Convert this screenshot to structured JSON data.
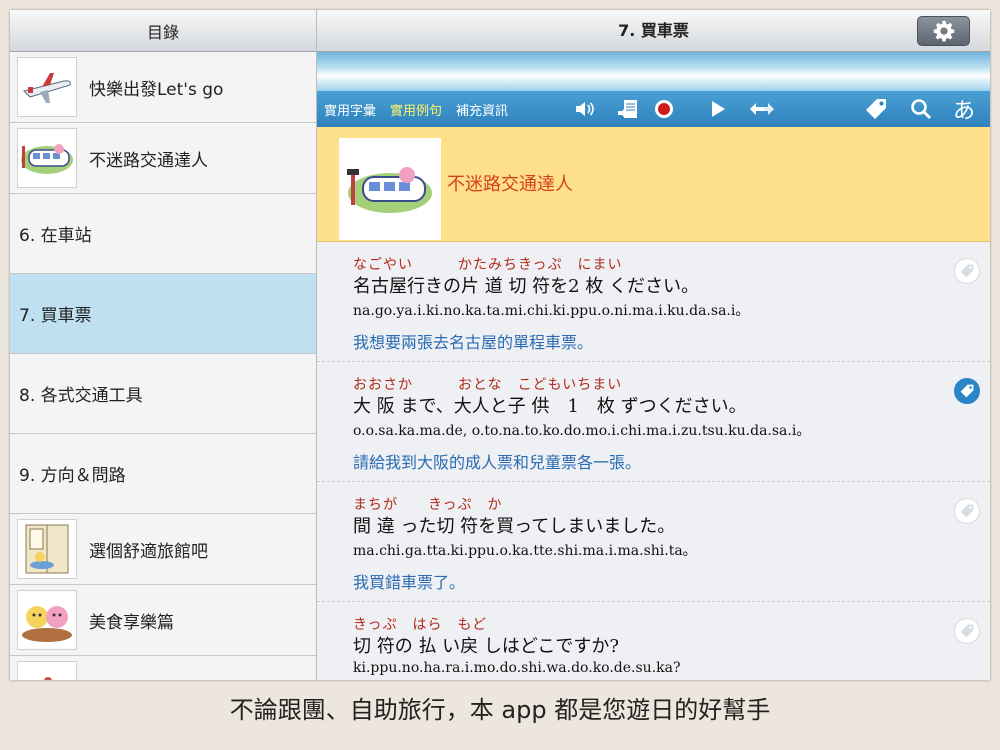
{
  "sidebar": {
    "title": "目錄",
    "items": [
      {
        "label": "快樂出發Let's go",
        "icon": "airplane-icon"
      },
      {
        "label": "不迷路交通達人",
        "icon": "train-icon"
      },
      {
        "label": "6. 在車站"
      },
      {
        "label": "7. 買車票"
      },
      {
        "label": "8. 各式交通工具"
      },
      {
        "label": "9. 方向＆問路"
      },
      {
        "label": "選個舒適旅館吧",
        "icon": "hotel-room-icon"
      },
      {
        "label": "美食享樂篇",
        "icon": "food-icon"
      }
    ],
    "selected_index": 3
  },
  "main": {
    "title": "7. 買車票",
    "tabs": [
      "實用字彙",
      "實用例句",
      "補充資訊"
    ],
    "active_tab": 1,
    "lang_button": "あ",
    "lesson_title": "不迷路交通達人",
    "phrases": [
      {
        "ruby": "なごやい　　　かたみちきっぷ　にまい",
        "japanese": "名古屋行きの片 道 切 符を2 枚 ください。",
        "romaji": "na.go.ya.i.ki.no.ka.ta.mi.chi.ki.ppu.o.ni.ma.i.ku.da.sa.i。",
        "chinese": "我想要兩張去名古屋的單程車票。",
        "tagged": false
      },
      {
        "ruby": "おおさか　　　おとな　こどもいちまい",
        "japanese": "大 阪 まで、大人と子 供　1　枚 ずつください。",
        "romaji": "o.o.sa.ka.ma.de, o.to.na.to.ko.do.mo.i.chi.ma.i.zu.tsu.ku.da.sa.i。",
        "chinese": "請給我到大阪的成人票和兒童票各一張。",
        "tagged": true
      },
      {
        "ruby": "まちが　　きっぷ　か",
        "japanese": "間 違 った切 符を買ってしまいました。",
        "romaji": "ma.chi.ga.tta.ki.ppu.o.ka.tte.shi.ma.i.ma.shi.ta。",
        "chinese": "我買錯車票了。",
        "tagged": false
      },
      {
        "ruby": "きっぷ　はら　もど",
        "japanese": "切 符の 払 い戻 しはどこですか?",
        "romaji": "ki.ppu.no.ha.ra.i.mo.do.shi.wa.do.ko.de.su.ka?",
        "chinese": "",
        "tagged": false
      }
    ]
  },
  "caption": "不論跟團、自助旅行，本 app 都是您遊日的好幫手",
  "colors": {
    "accent": "#2f82bd",
    "selected": "#bfe0f1",
    "lesson_bg": "#ffe08a",
    "chinese_text": "#2a6bb3",
    "ruby_text": "#b22a1a"
  }
}
